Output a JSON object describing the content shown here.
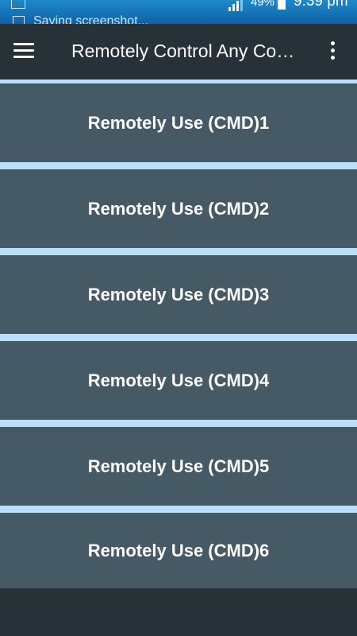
{
  "status_bar": {
    "ticker": "Saving screenshot...",
    "battery": "49%",
    "time": "9:39 pm"
  },
  "app_bar": {
    "title": "Remotely Control Any Computer"
  },
  "buttons": [
    {
      "label": "Remotely Use (CMD)1"
    },
    {
      "label": "Remotely Use (CMD)2"
    },
    {
      "label": "Remotely Use (CMD)3"
    },
    {
      "label": "Remotely Use (CMD)4"
    },
    {
      "label": "Remotely Use (CMD)5"
    },
    {
      "label": "Remotely Use (CMD)6"
    }
  ],
  "colors": {
    "app_bar": "#263238",
    "button": "#455a64",
    "separator": "#bbdefb",
    "status_bar": "#1976d2"
  },
  "icons": [
    "hamburger-menu-icon",
    "more-vert-icon",
    "signal-icon",
    "battery-icon",
    "screenshot-icon"
  ]
}
